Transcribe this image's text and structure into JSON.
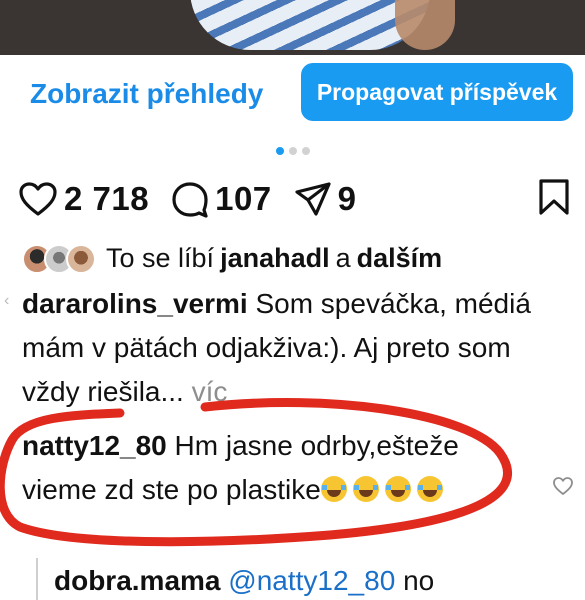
{
  "buttons": {
    "insights": "Zobrazit přehledy",
    "promote": "Propagovat příspěvek"
  },
  "carousel": {
    "count": 3,
    "active": 1
  },
  "stats": {
    "likes": "2 718",
    "comments": "107",
    "shares": "9"
  },
  "liked_by": {
    "prefix": "To se líbí",
    "user": "janahadl",
    "conj": "a",
    "suffix": "dalším"
  },
  "caption": {
    "author": "dararolins_vermi",
    "text": "Som speváčka, médiá mám v pätách odjakživa:). Aj preto som vždy riešila...",
    "more": "víc"
  },
  "comment": {
    "author": "natty12_80",
    "text": "Hm jasne odrby,ešteže vieme zd ste po plastike",
    "emoji_count": 4,
    "emoji_name": "face-with-tears-of-joy"
  },
  "reply": {
    "author": "dobra.mama",
    "mention": "@natty12_80",
    "text": "no"
  },
  "colors": {
    "accent": "#1a9bf2",
    "link": "#1a8ce8",
    "annotation": "#e02a1e"
  },
  "icons": [
    "heart-icon",
    "comment-icon",
    "share-icon",
    "bookmark-icon",
    "small-heart-icon"
  ]
}
